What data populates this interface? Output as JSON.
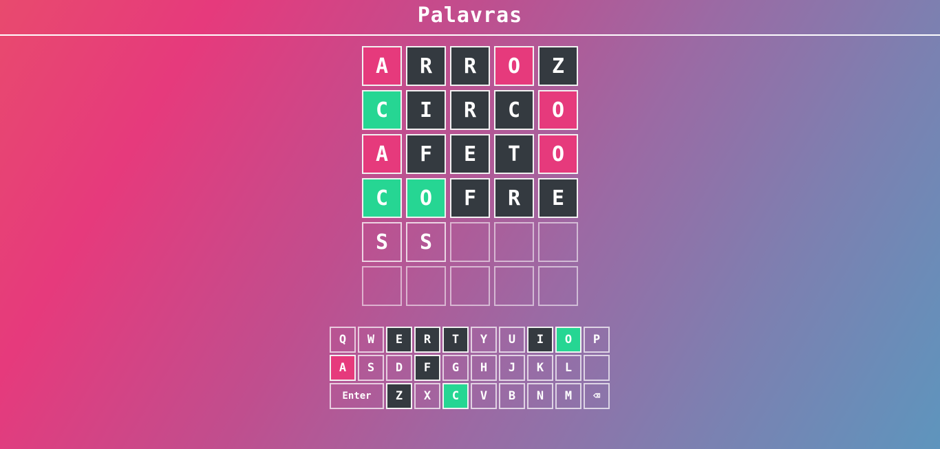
{
  "app": {
    "title": "Palavras"
  },
  "board": {
    "rows": [
      [
        {
          "letter": "A",
          "state": "present"
        },
        {
          "letter": "R",
          "state": "absent"
        },
        {
          "letter": "R",
          "state": "absent"
        },
        {
          "letter": "O",
          "state": "present"
        },
        {
          "letter": "Z",
          "state": "absent"
        }
      ],
      [
        {
          "letter": "C",
          "state": "correct"
        },
        {
          "letter": "I",
          "state": "absent"
        },
        {
          "letter": "R",
          "state": "absent"
        },
        {
          "letter": "C",
          "state": "absent"
        },
        {
          "letter": "O",
          "state": "present"
        }
      ],
      [
        {
          "letter": "A",
          "state": "present"
        },
        {
          "letter": "F",
          "state": "absent"
        },
        {
          "letter": "E",
          "state": "absent"
        },
        {
          "letter": "T",
          "state": "absent"
        },
        {
          "letter": "O",
          "state": "present"
        }
      ],
      [
        {
          "letter": "C",
          "state": "correct"
        },
        {
          "letter": "O",
          "state": "correct"
        },
        {
          "letter": "F",
          "state": "absent"
        },
        {
          "letter": "R",
          "state": "absent"
        },
        {
          "letter": "E",
          "state": "absent"
        }
      ],
      [
        {
          "letter": "S",
          "state": "entered"
        },
        {
          "letter": "S",
          "state": "entered"
        },
        {
          "letter": "",
          "state": "empty"
        },
        {
          "letter": "",
          "state": "empty"
        },
        {
          "letter": "",
          "state": "empty"
        }
      ],
      [
        {
          "letter": "",
          "state": "empty"
        },
        {
          "letter": "",
          "state": "empty"
        },
        {
          "letter": "",
          "state": "empty"
        },
        {
          "letter": "",
          "state": "empty"
        },
        {
          "letter": "",
          "state": "empty"
        }
      ]
    ]
  },
  "keyboard": {
    "rows": [
      [
        {
          "label": "Q",
          "state": ""
        },
        {
          "label": "W",
          "state": ""
        },
        {
          "label": "E",
          "state": "absent"
        },
        {
          "label": "R",
          "state": "absent"
        },
        {
          "label": "T",
          "state": "absent"
        },
        {
          "label": "Y",
          "state": ""
        },
        {
          "label": "U",
          "state": ""
        },
        {
          "label": "I",
          "state": "absent"
        },
        {
          "label": "O",
          "state": "correct"
        },
        {
          "label": "P",
          "state": ""
        }
      ],
      [
        {
          "label": "A",
          "state": "present"
        },
        {
          "label": "S",
          "state": ""
        },
        {
          "label": "D",
          "state": ""
        },
        {
          "label": "F",
          "state": "absent"
        },
        {
          "label": "G",
          "state": ""
        },
        {
          "label": "H",
          "state": ""
        },
        {
          "label": "J",
          "state": ""
        },
        {
          "label": "K",
          "state": ""
        },
        {
          "label": "L",
          "state": ""
        },
        {
          "label": "",
          "state": ""
        }
      ],
      [
        {
          "label": "Enter",
          "state": "",
          "wide": true,
          "name": "enter-key"
        },
        {
          "label": "Z",
          "state": "absent"
        },
        {
          "label": "X",
          "state": ""
        },
        {
          "label": "C",
          "state": "correct"
        },
        {
          "label": "V",
          "state": ""
        },
        {
          "label": "B",
          "state": ""
        },
        {
          "label": "N",
          "state": ""
        },
        {
          "label": "M",
          "state": ""
        },
        {
          "label": "⌫",
          "state": "",
          "name": "backspace-key",
          "icon": "backspace-icon"
        }
      ]
    ]
  },
  "colors": {
    "absent": "#343a40",
    "present": "#e63a7c",
    "correct": "#26d693"
  }
}
